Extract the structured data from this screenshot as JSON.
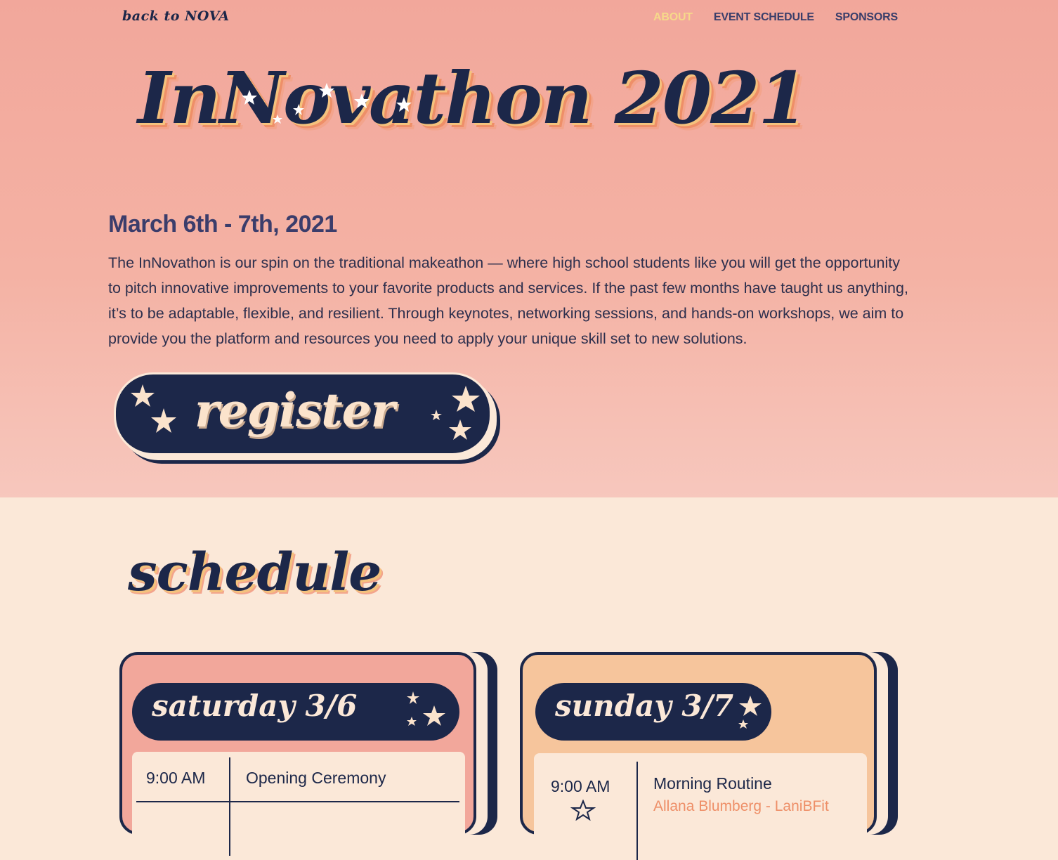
{
  "nav": {
    "logo": "back to NOVA",
    "links": [
      "ABOUT",
      "EVENT SCHEDULE",
      "SPONSORS"
    ]
  },
  "hero": {
    "title": "InNovathon 2021",
    "dates": "March 6th - 7th, 2021",
    "description": "The InNovathon is our spin on the traditional makeathon — where high school students like you will get the opportunity to pitch innovative improvements to your favorite products and services. If the past few months have taught us anything, it’s to be adaptable, flexible, and resilient. Through keynotes, networking sessions, and hands-on workshops, we aim to provide you the platform and resources you need to apply your unique skill set to new solutions.",
    "register_label": "register"
  },
  "schedule": {
    "title": "schedule",
    "days": [
      {
        "label": "saturday 3/6",
        "color": "#f2a79b",
        "events": [
          {
            "time": "9:00 AM",
            "title": "Opening Ceremony",
            "speaker": ""
          }
        ]
      },
      {
        "label": "sunday 3/7",
        "color": "#f6c59c",
        "events": [
          {
            "time": "9:00 AM",
            "title": "Morning Routine",
            "speaker": "Allana Blumberg - LaniBFit"
          }
        ]
      }
    ]
  },
  "colors": {
    "navy": "#1c2749",
    "cream": "#fbe8d8",
    "active_link": "#f6d98a",
    "speaker": "#ee8f68"
  },
  "icons": [
    "star-icon"
  ]
}
